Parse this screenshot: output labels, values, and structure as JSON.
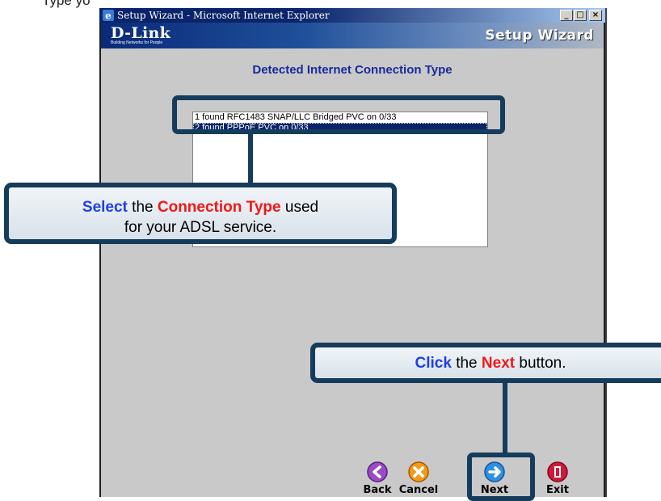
{
  "page_heading_fragment": "Type yo",
  "window": {
    "title": "Setup Wizard - Microsoft Internet Explorer",
    "caption_buttons": [
      "_",
      "□",
      "×"
    ]
  },
  "header": {
    "brand": "D-Link",
    "brand_tagline": "Building Networks for People",
    "wizard_label": "Setup Wizard"
  },
  "page_title": "Detected Internet Connection Type",
  "connection_list": {
    "items": [
      "1 found RFC1483 SNAP/LLC Bridged PVC on 0/33",
      "2 found PPPoE PVC on 0/33"
    ],
    "selected_index": 1
  },
  "callout_select": {
    "verb": "Select",
    "text_a": " the ",
    "highlight": "Connection Type",
    "text_b": " used",
    "line2": "for your ADSL service."
  },
  "callout_click": {
    "verb": "Click",
    "text_a": " the ",
    "highlight": "Next",
    "text_b": " button."
  },
  "nav_buttons": {
    "back": "Back",
    "cancel": "Cancel",
    "next": "Next",
    "exit": "Exit"
  },
  "colors": {
    "titlebar": "#0a246a",
    "panel": "#c9c9c9",
    "callout_border": "#163c5c",
    "accent_blue": "#1e3fe6",
    "accent_red": "#f01818"
  },
  "icons": {
    "app": "ie-icon",
    "back": "back-arrow-icon",
    "cancel": "cancel-x-icon",
    "next": "next-arrow-icon",
    "exit": "exit-door-icon"
  }
}
